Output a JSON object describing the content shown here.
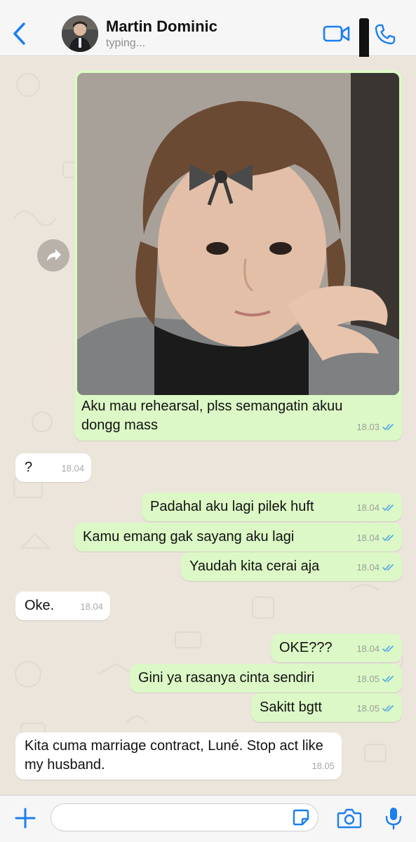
{
  "header": {
    "contact_name": "Martin Dominic",
    "status": "typing...",
    "icons": {
      "back": "chevron-left-icon",
      "video": "video-camera-icon",
      "call": "phone-icon"
    }
  },
  "messages": [
    {
      "direction": "outgoing",
      "type": "image",
      "text": "Aku mau rehearsal, plss semangatin akuu dongg mass",
      "time": "18.03",
      "ticks": "read"
    },
    {
      "direction": "incoming",
      "text": "?",
      "time": "18.04"
    },
    {
      "direction": "outgoing",
      "text": "Padahal aku lagi pilek huft",
      "time": "18.04",
      "ticks": "read"
    },
    {
      "direction": "outgoing",
      "text": "Kamu emang gak sayang aku lagi",
      "time": "18.04",
      "ticks": "read"
    },
    {
      "direction": "outgoing",
      "text": "Yaudah kita cerai aja",
      "time": "18.04",
      "ticks": "read"
    },
    {
      "direction": "incoming",
      "text": "Oke.",
      "time": "18.04"
    },
    {
      "direction": "outgoing",
      "text": "OKE???",
      "time": "18.04",
      "ticks": "read"
    },
    {
      "direction": "outgoing",
      "text": "Gini ya rasanya cinta sendiri",
      "time": "18.05",
      "ticks": "read"
    },
    {
      "direction": "outgoing",
      "text": "Sakitt bgtt",
      "time": "18.05",
      "ticks": "read"
    },
    {
      "direction": "incoming",
      "text": "Kita cuma marriage contract, Luné. Stop act like my husband.",
      "time": "18.05"
    }
  ],
  "input": {
    "value": "",
    "placeholder": ""
  },
  "colors": {
    "accent": "#1a7ff0",
    "outgoing_bubble": "#dcf8c6",
    "incoming_bubble": "#ffffff",
    "read_ticks": "#4fa8e8"
  }
}
